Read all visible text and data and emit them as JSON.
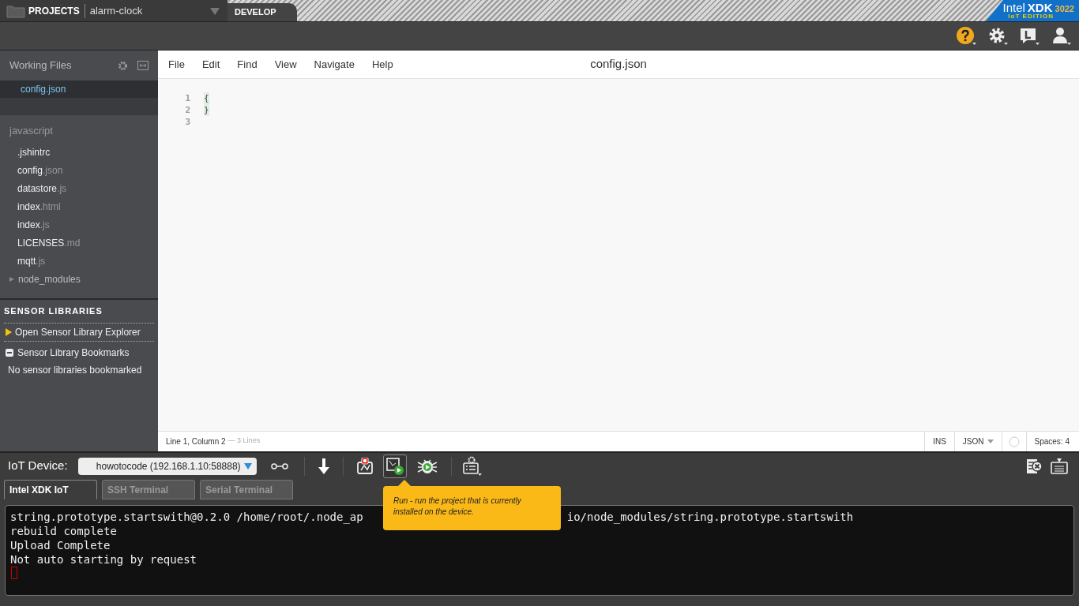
{
  "header": {
    "projects_label": "PROJECTS",
    "project": "alarm-clock",
    "tabs": [
      {
        "label": "DEVELOP",
        "selected": true
      }
    ],
    "brand": {
      "name": "Intel",
      "product": "XDK",
      "edition": "IoT EDITION",
      "build": "3022"
    }
  },
  "sidebar": {
    "working_files_title": "Working Files",
    "working_files": [
      {
        "name": "config",
        "ext": ".json",
        "selected": true
      }
    ],
    "folder": "javascript",
    "files": [
      {
        "name": ".jshintrc",
        "kind": "file"
      },
      {
        "name": "config",
        "ext": ".json",
        "kind": "file"
      },
      {
        "name": "datastore",
        "ext": ".js",
        "kind": "file"
      },
      {
        "name": "index",
        "ext": ".html",
        "kind": "file"
      },
      {
        "name": "index",
        "ext": ".js",
        "kind": "file"
      },
      {
        "name": "LICENSES",
        "ext": ".md",
        "kind": "file"
      },
      {
        "name": "mqtt",
        "ext": ".js",
        "kind": "file"
      },
      {
        "name": "node_modules",
        "kind": "folder",
        "expanded": false
      }
    ],
    "sensor_title": "SENSOR LIBRARIES",
    "sensor_explorer": "Open Sensor Library Explorer",
    "bookmarks_title": "Sensor Library Bookmarks",
    "bookmarks_empty": "No sensor libraries bookmarked"
  },
  "editor": {
    "menu": [
      "File",
      "Edit",
      "Find",
      "View",
      "Navigate",
      "Help"
    ],
    "file_title": "config.json",
    "lines": [
      {
        "number": "1",
        "text": "{"
      },
      {
        "number": "2",
        "text": "}"
      },
      {
        "number": "3"
      }
    ],
    "status": {
      "position": "Line 1, Column 2",
      "lines": "— 3 Lines",
      "mode": "INS",
      "language": "JSON",
      "spaces": "Spaces: 4"
    }
  },
  "iot": {
    "label": "IoT Device:",
    "device": "howotocode (192.168.1.10:58888)",
    "tabs": [
      {
        "label": "Intel XDK IoT",
        "selected": true
      },
      {
        "label": "SSH Terminal",
        "selected": false
      },
      {
        "label": "Serial Terminal",
        "selected": false
      }
    ],
    "tooltip": "Run - run the project that is currently installed on the device.",
    "terminal": [
      {
        "left": "string.prototype.startswith@0.2.0 /home/root/.node_ap",
        "right": "io/node_modules/string.prototype.startswith"
      },
      {
        "left": "rebuild complete"
      },
      {
        "left": "Upload Complete"
      },
      {
        "left": "Not auto starting by request"
      }
    ]
  }
}
